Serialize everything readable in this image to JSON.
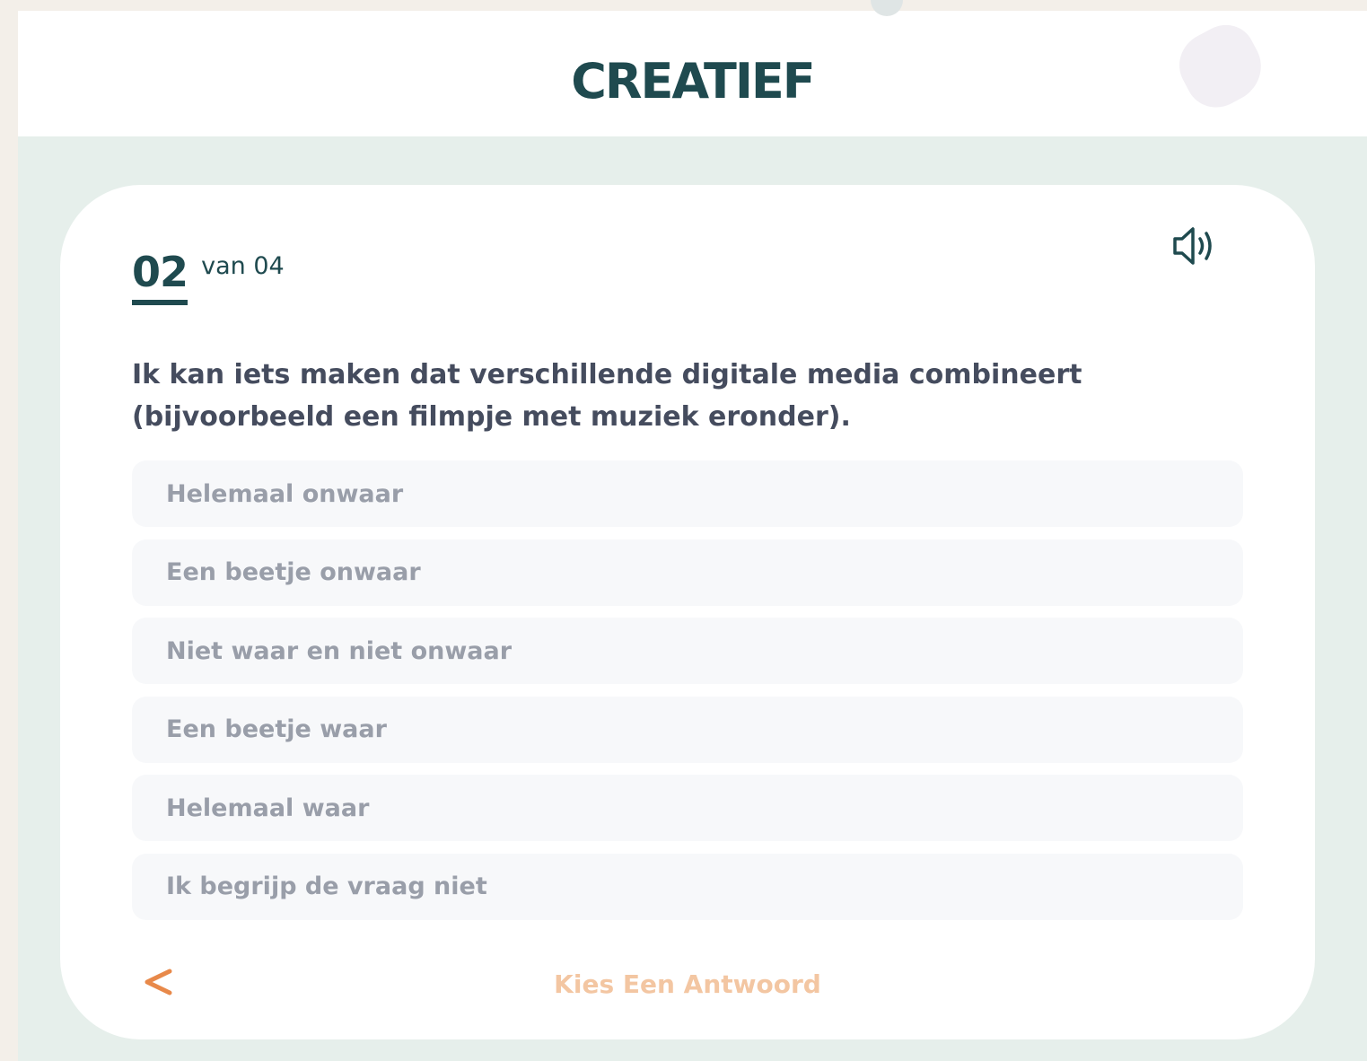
{
  "header": {
    "title": "CREATIEF"
  },
  "progress": {
    "current": "02",
    "total_label": "van 04"
  },
  "question": {
    "text": "Ik kan iets maken dat verschillende digitale media combineert (bijvoorbeeld een filmpje met muziek eronder)."
  },
  "options": [
    {
      "label": "Helemaal onwaar"
    },
    {
      "label": "Een beetje onwaar"
    },
    {
      "label": "Niet waar en niet onwaar"
    },
    {
      "label": "Een beetje waar"
    },
    {
      "label": "Helemaal waar"
    },
    {
      "label": "Ik begrijp de vraag niet"
    }
  ],
  "footer": {
    "back_label": "<",
    "submit_label": "Kies Een Antwoord"
  },
  "icons": {
    "sound": "speaker-icon",
    "back": "chevron-left-icon"
  },
  "colors": {
    "primary": "#1f4a4f",
    "accent": "#e8894a",
    "accent_disabled": "#f3c6a2",
    "background": "#e6efeb"
  }
}
